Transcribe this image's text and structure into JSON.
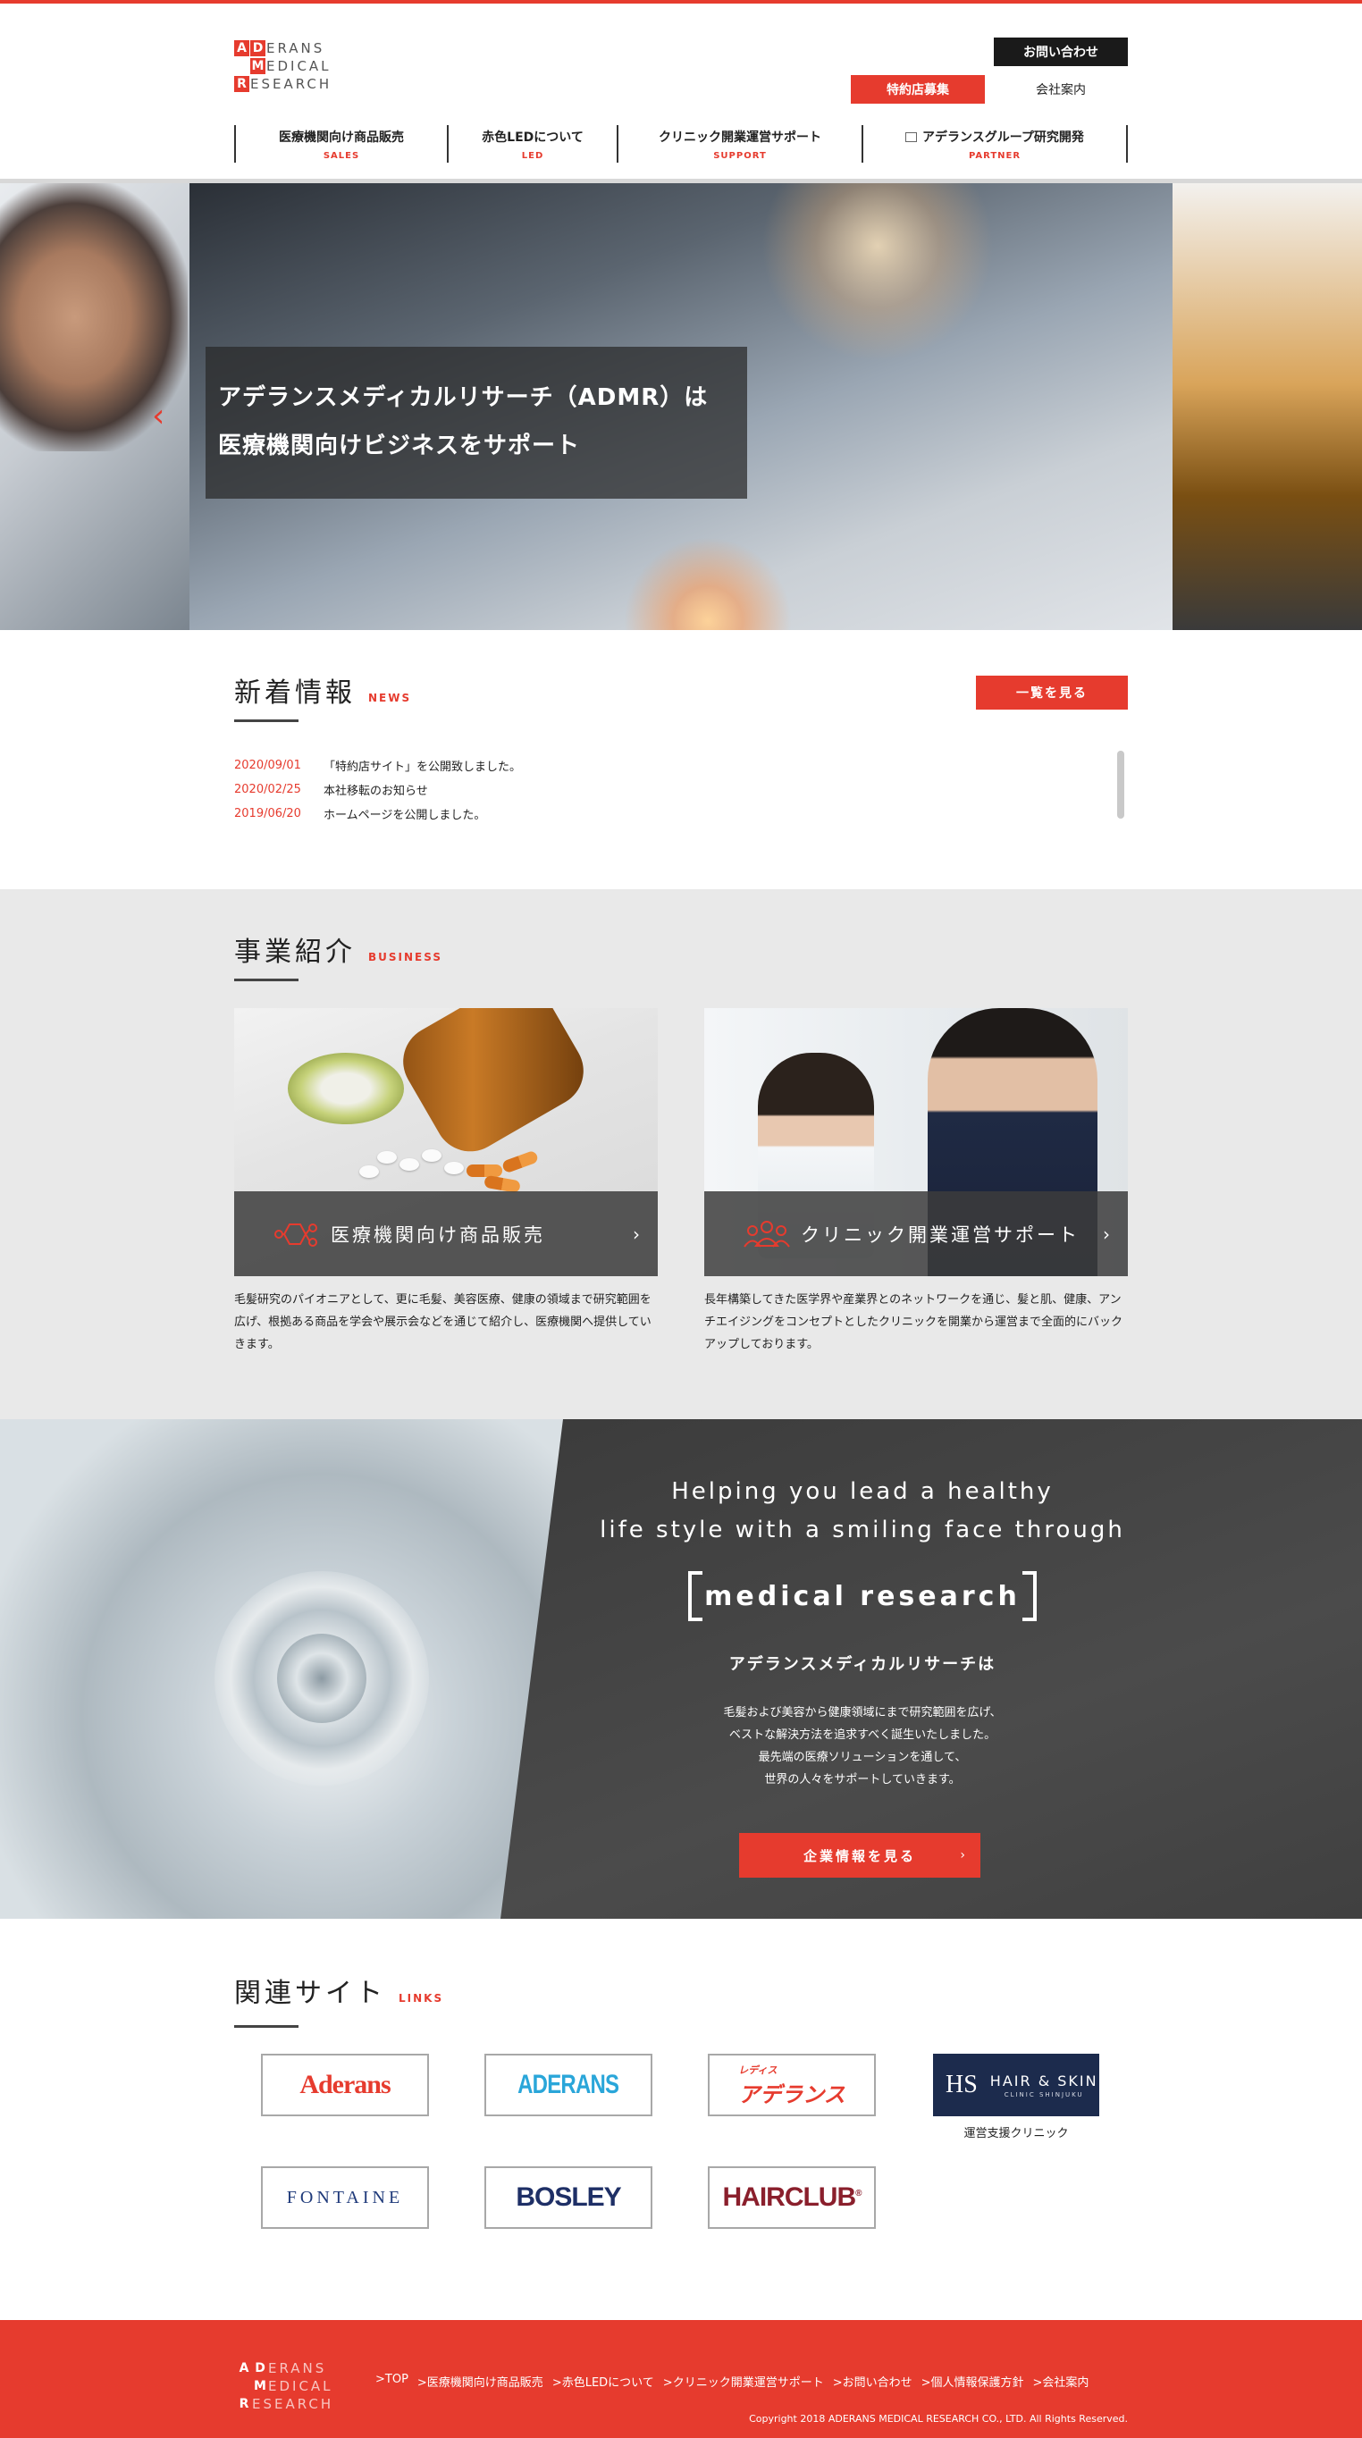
{
  "logo": {
    "letters": [
      "A",
      "D",
      "M",
      "R"
    ],
    "rows": [
      "ERANS",
      "EDICAL",
      "ESEARCH"
    ]
  },
  "header": {
    "contact": "お問い合わせ",
    "agent_recruit": "特約店募集",
    "company": "会社案内"
  },
  "nav": [
    {
      "jp": "医療機関向け商品販売",
      "en": "SALES"
    },
    {
      "jp": "赤色LEDについて",
      "en": "LED"
    },
    {
      "jp": "クリニック開業運営サポート",
      "en": "SUPPORT"
    },
    {
      "jp": "アデランスグループ研究開発",
      "en": "PARTNER"
    }
  ],
  "hero": {
    "line1": "アデランスメディカルリサーチ（ADMR）は",
    "line2": "医療機関向けビジネスをサポート",
    "prev": "‹"
  },
  "news": {
    "title": "新着情報",
    "en": "NEWS",
    "more": "一覧を見る",
    "items": [
      {
        "date": "2020/09/01",
        "text": "「特約店サイト」を公開致しました。"
      },
      {
        "date": "2020/02/25",
        "text": "本社移転のお知らせ"
      },
      {
        "date": "2019/06/20",
        "text": "ホームページを公開しました。"
      }
    ]
  },
  "business": {
    "title": "事業紹介",
    "en": "BUSINESS",
    "cards": [
      {
        "label": "医療機関向け商品販売",
        "chev": "›",
        "desc": "毛髪研究のパイオニアとして、更に毛髪、美容医療、健康の領域まで研究範囲を広げ、根拠ある商品を学会や展示会などを通じて紹介し、医療機関へ提供していきます。"
      },
      {
        "label": "クリニック開業運営サポート",
        "chev": "›",
        "desc": "長年構築してきた医学界や産業界とのネットワークを通じ、髪と肌、健康、アンチエイジングをコンセプトとしたクリニックを開業から運営まで全面的にバックアップしております。"
      }
    ]
  },
  "mission": {
    "line1": "Helping you lead a healthy",
    "line2": "life style with a smiling face through",
    "highlight": "medical research",
    "company": "アデランスメディカルリサーチは",
    "desc": [
      "毛髪および美容から健康領域にまで研究範囲を広げ、",
      "ベストな解決方法を追求すべく誕生いたしました。",
      "最先端の医療ソリューションを通して、",
      "世界の人々をサポートしていきます。"
    ],
    "button": "企業情報を見る",
    "chev": "›"
  },
  "links": {
    "title": "関連サイト",
    "en": "LINKS",
    "aderans1": "Aderans",
    "aderans2": "ADERANS",
    "ladies_small": "レディス",
    "ladies": "アデランス",
    "hs_mark": "HS",
    "hs_title": "HAIR & SKIN",
    "hs_sub": "CLINIC SHINJUKU",
    "hs_caption": "運営支援クリニック",
    "fontaine": "FONTAINE",
    "bosley": "BOSLEY",
    "hairclub": "HAIRCLUB",
    "hairclub_reg": "®"
  },
  "footer": {
    "nav": [
      ">TOP",
      ">医療機関向け商品販売",
      ">赤色LEDについて",
      ">クリニック開業運営サポート",
      ">お問い合わせ",
      ">個人情報保護方針",
      ">会社案内"
    ],
    "copyright": "Copyright 2018 ADERANS MEDICAL RESEARCH CO., LTD. All Rights Reserved."
  },
  "colors": {
    "accent": "#e63b2e",
    "dark": "#1a1a1a",
    "gray_bg": "#e9e9e9"
  }
}
